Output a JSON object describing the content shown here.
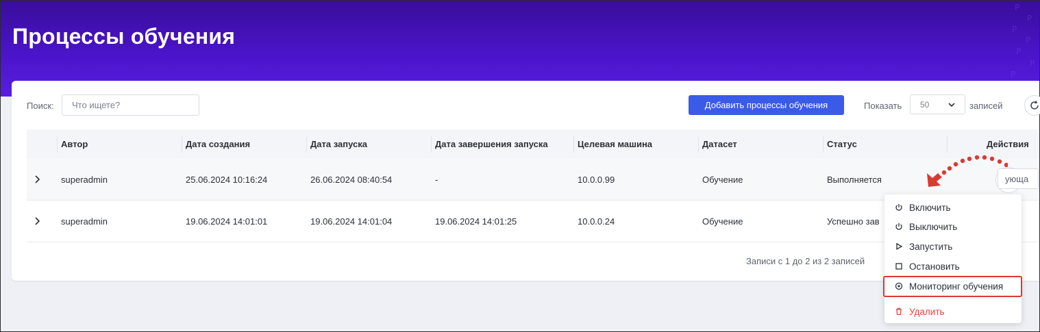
{
  "header": {
    "title": "Процессы обучения"
  },
  "toolbar": {
    "search_label": "Поиск:",
    "search_placeholder": "Что ищете?",
    "search_value": "",
    "add_button": "Добавить процессы обучения",
    "show_label": "Показать",
    "page_size": "50",
    "records_label": "записей"
  },
  "table": {
    "columns": [
      "Автор",
      "Дата создания",
      "Дата запуска",
      "Дата завершения запуска",
      "Целевая машина",
      "Датасет",
      "Статус",
      "Действия"
    ],
    "rows": [
      {
        "author": "superadmin",
        "created": "25.06.2024 10:16:24",
        "started": "26.06.2024 08:40:54",
        "finished": "-",
        "machine": "10.0.0.99",
        "dataset": "Обучение",
        "status": "Выполняется"
      },
      {
        "author": "superadmin",
        "created": "19.06.2024 14:01:01",
        "started": "19.06.2024 14:01:04",
        "finished": "19.06.2024 14:01:25",
        "machine": "10.0.0.24",
        "dataset": "Обучение",
        "status": "Успешно зав"
      }
    ]
  },
  "pagination": {
    "info": "Записи с 1 до 2 из 2 записей",
    "next_partial": "ующа"
  },
  "actions_menu": {
    "items": [
      {
        "label": "Включить",
        "icon": "power-icon"
      },
      {
        "label": "Выключить",
        "icon": "power-icon"
      },
      {
        "label": "Запустить",
        "icon": "play-icon"
      },
      {
        "label": "Остановить",
        "icon": "stop-icon"
      },
      {
        "label": "Мониторинг обучения",
        "icon": "monitor-icon",
        "highlighted": true
      },
      {
        "label": "Удалить",
        "icon": "trash-icon",
        "danger": true
      }
    ]
  },
  "colors": {
    "brand_gradient": [
      "#3a0d9a",
      "#5a1ee0"
    ],
    "primary_button": "#3a5ae8",
    "danger": "#e0443a",
    "annotation": "#d93a32"
  }
}
